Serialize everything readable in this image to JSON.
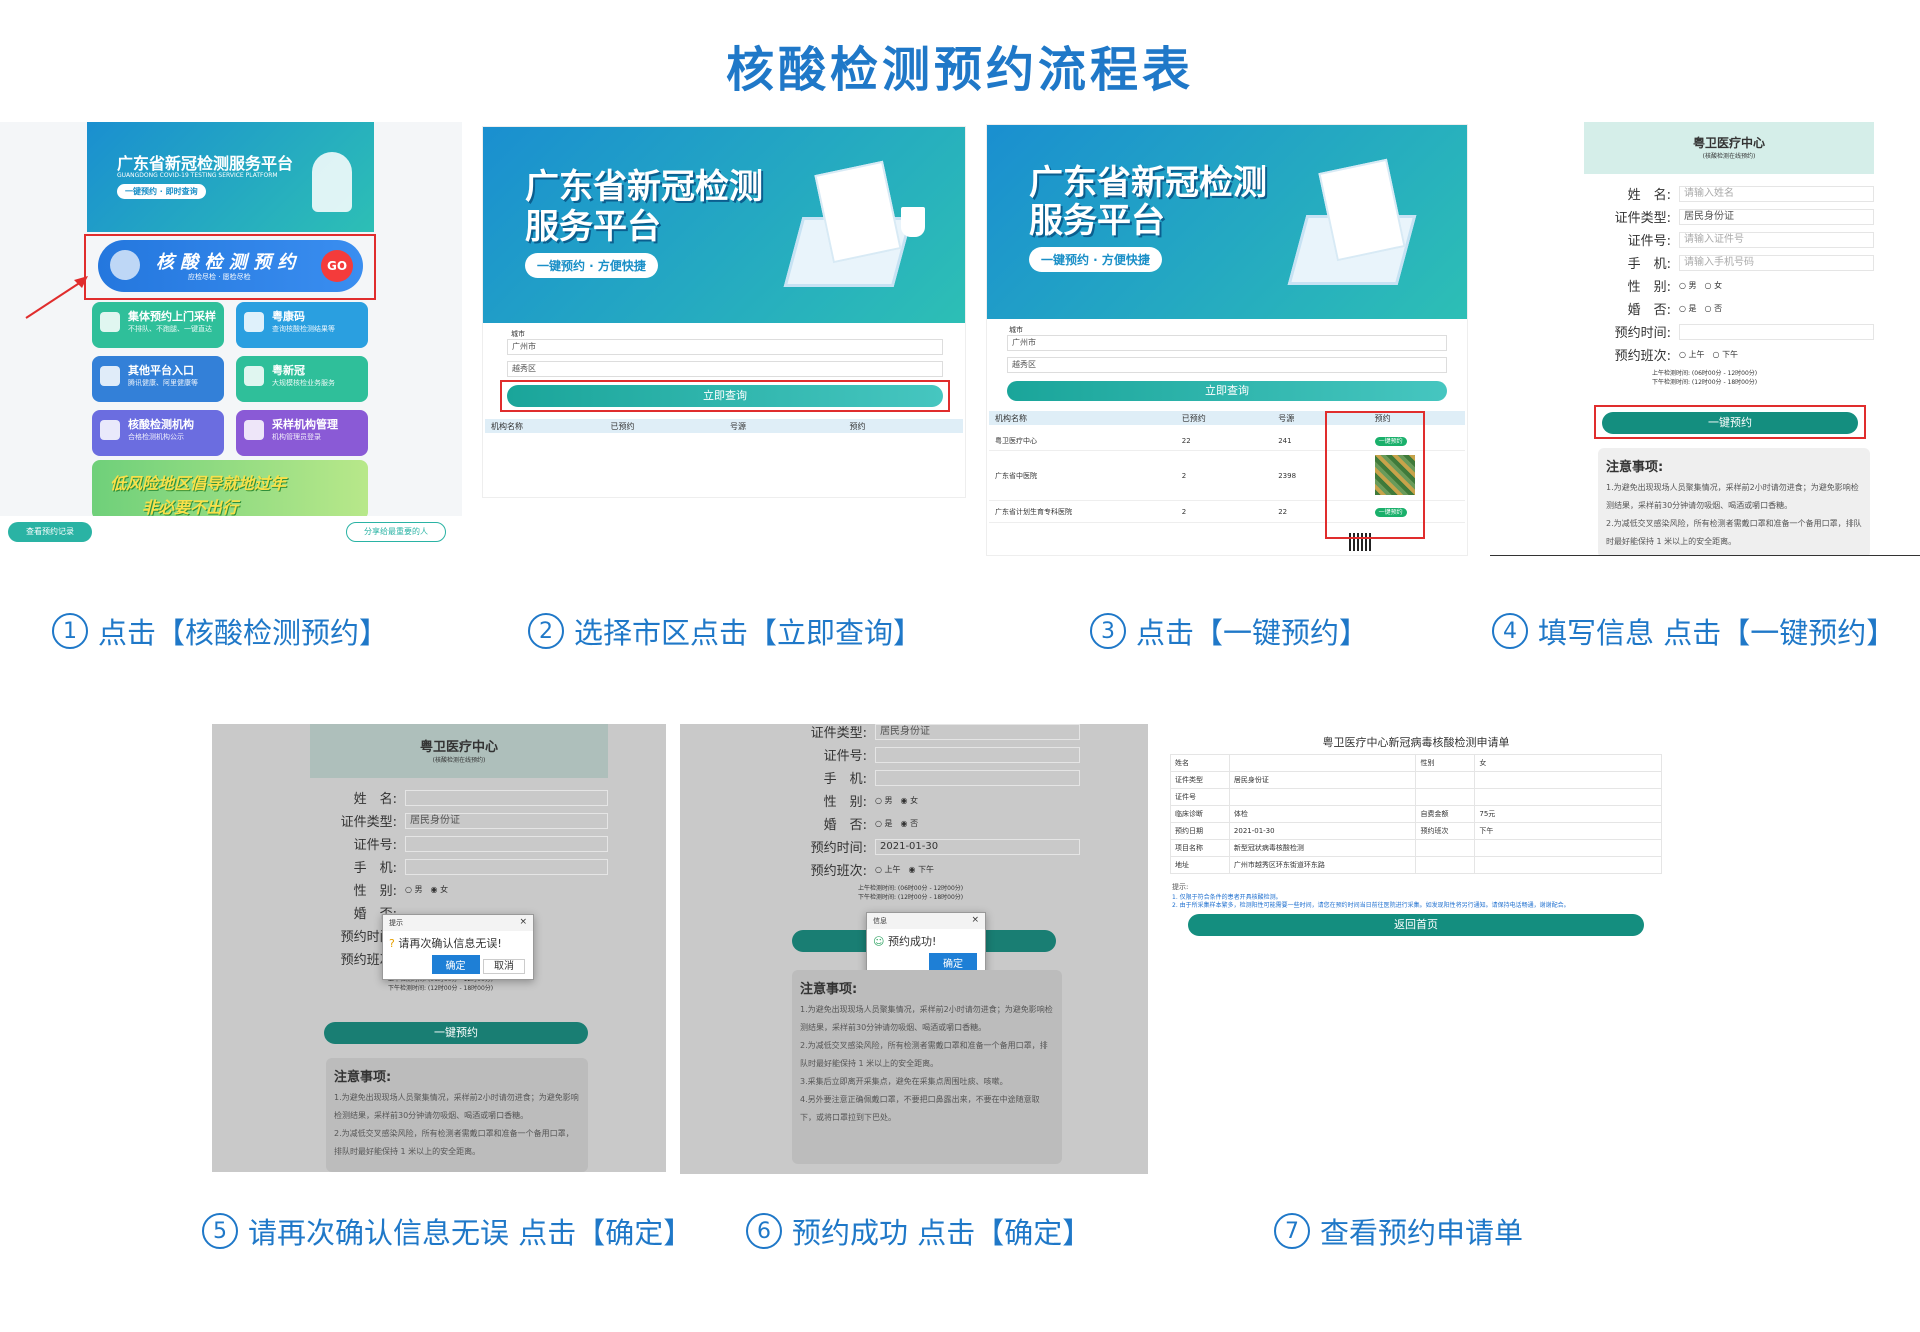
{
  "title": "核酸检测预约流程表",
  "steps": [
    {
      "num": "1",
      "text": "点击【核酸检测预约】"
    },
    {
      "num": "2",
      "text": "选择市区点击【立即查询】"
    },
    {
      "num": "3",
      "text": "点击【一键预约】"
    },
    {
      "num": "4",
      "text": "填写信息 点击【一键预约】"
    },
    {
      "num": "5",
      "text": "请再次确认信息无误 点击【确定】"
    },
    {
      "num": "6",
      "text": "预约成功 点击【确定】"
    },
    {
      "num": "7",
      "text": "查看预约申请单"
    }
  ],
  "s1": {
    "banner_title": "广东省新冠检测服务平台",
    "banner_sub": "GUANGDONG COVID-19 TESTING SERVICE PLATFORM",
    "banner_pill": "一键预约 · 即时查询",
    "main_btn": "核 酸 检 测 预 约",
    "main_btn_sub": "应检尽检 · 愿检尽检",
    "go": "GO",
    "tiles": [
      {
        "t": "集体预约上门采样",
        "s": "不排队、不跑腿、一键直达",
        "c": "#2fbf9a"
      },
      {
        "t": "粤康码",
        "s": "查询核酸检测结果等",
        "c": "#2a9fe0"
      },
      {
        "t": "其他平台入口",
        "s": "腾讯健康、阿里健康等",
        "c": "#3380d8"
      },
      {
        "t": "粤新冠",
        "s": "大规模核检业务服务",
        "c": "#2fbf9a"
      },
      {
        "t": "核酸检测机构",
        "s": "合格检测机构公示",
        "c": "#6b6de0"
      },
      {
        "t": "采样机构管理",
        "s": "机构管理员登录",
        "c": "#8a5ad6"
      }
    ],
    "promo1": "低风险地区倡导就地过年",
    "promo2": "非必要不出行",
    "record_btn": "查看预约记录",
    "share_btn": "分享给最重要的人"
  },
  "s2": {
    "banner_title1": "广东省新冠检测",
    "banner_title2": "服务平台",
    "banner_pill": "一键预约 · 方便快捷",
    "city_label": "城市",
    "city": "广州市",
    "district": "越秀区",
    "query_btn": "立即查询",
    "cols": [
      "机构名称",
      "已预约",
      "号源",
      "预约"
    ]
  },
  "s3": {
    "cols": [
      "机构名称",
      "已预约",
      "号源",
      "预约"
    ],
    "rows": [
      {
        "name": "粤卫医疗中心",
        "booked": "22",
        "quota": "241"
      },
      {
        "name": "广东省中医院",
        "booked": "2",
        "quota": "2398"
      },
      {
        "name": "广东省计划生育专科医院",
        "booked": "2",
        "quota": "22"
      }
    ],
    "book_btn": "一键预约"
  },
  "form": {
    "header": "粤卫医疗中心",
    "header_sub": "(核酸检测在线预约)",
    "labels": [
      "姓　名:",
      "证件类型:",
      "证件号:",
      "手　机:",
      "性　别:",
      "婚　否:",
      "预约时间:",
      "预约班次:"
    ],
    "ph_name": "请输入姓名",
    "id_type": "居民身份证",
    "ph_id": "请输入证件号",
    "ph_phone": "请输入手机号码",
    "male": "男",
    "female": "女",
    "yes": "是",
    "no": "否",
    "am": "上午",
    "pm": "下午",
    "am_time": "上午检测时间: (06时00分 - 12时00分)",
    "pm_time": "下午检测时间: (12时00分 - 18时00分)",
    "submit": "一键预约",
    "notes_title": "注意事项:",
    "notes": [
      "1.为避免出现现场人员聚集情况，采样前2小时请勿进食；为避免影响检测结果，采样前30分钟请勿吸烟、喝酒或嚼口香糖。",
      "2.为减低交叉感染风险，所有检测者需戴口罩和准备一个备用口罩，排队时最好能保持 1 米以上的安全距离。",
      "3.采集后立即离开采集点，避免在采集点周围吐痰、咳嗽。",
      "4.另外要注意正确佩戴口罩，不要把口鼻露出来，不要在中途随意取下，或将口罩拉到下巴处。"
    ],
    "date": "2021-01-30"
  },
  "dlg5": {
    "title": "提示",
    "msg": "请再次确认信息无误!",
    "ok": "确定",
    "cancel": "取消"
  },
  "dlg6": {
    "title": "信息",
    "msg": "预约成功!",
    "ok": "确定"
  },
  "s7": {
    "title": "粤卫医疗中心新冠病毒核酸检测申请单",
    "rows": [
      [
        "姓名",
        "",
        "性别",
        "女"
      ],
      [
        "证件类型",
        "居民身份证",
        "",
        ""
      ],
      [
        "证件号",
        "",
        "",
        ""
      ],
      [
        "临床诊断",
        "体检",
        "自费金额",
        "75元"
      ],
      [
        "预约日期",
        "2021-01-30",
        "预约班次",
        "下午"
      ],
      [
        "项目名称",
        "新型冠状病毒核酸检测",
        "",
        ""
      ],
      [
        "地址",
        "广州市越秀区环东街道环东路",
        "",
        ""
      ]
    ],
    "tip_title": "提示:",
    "tip1": "1. 仅限于符合条件的患者开具核酸检测。",
    "tip2": "2. 由于所采集样本繁多，检测阳性可能需要一些时间，请您在预约时间当日前往医院进行采集。如发现阳性将另行通知。请保持电话畅通，谢谢配合。",
    "home_btn": "返回首页"
  }
}
